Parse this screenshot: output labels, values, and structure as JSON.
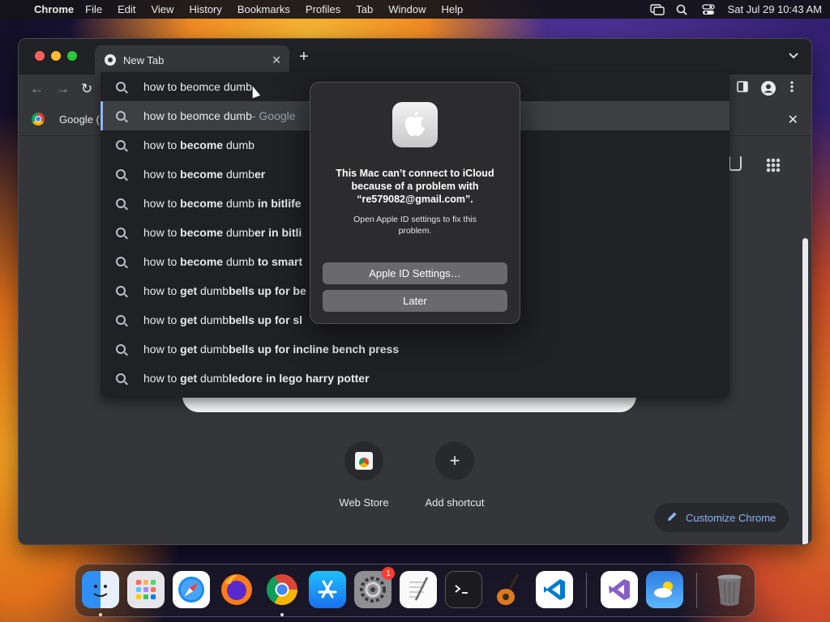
{
  "menubar": {
    "app_name": "Chrome",
    "menus": [
      "File",
      "Edit",
      "View",
      "History",
      "Bookmarks",
      "Profiles",
      "Tab",
      "Window",
      "Help"
    ],
    "datetime": "Sat Jul 29  10:43 AM"
  },
  "browser": {
    "tab_title": "New Tab",
    "bookmark_label": "Google (",
    "omnibox_text": "how to beomce dumb"
  },
  "suggestions": [
    {
      "plain": "how to beomce dumb",
      "bold": "",
      "tail": "",
      "suffix": " - Google"
    },
    {
      "plain": "how to ",
      "bold": "become",
      "tail": " dumb",
      "suffix": ""
    },
    {
      "plain": "how to ",
      "bold": "become",
      "tail": " dumb",
      "bold2": "er",
      "suffix": ""
    },
    {
      "plain": "how to ",
      "bold": "become",
      "tail": " dumb",
      "bold2": " in bitlife",
      "suffix": ""
    },
    {
      "plain": "how to ",
      "bold": "become",
      "tail": " dumb",
      "bold2": "er in bitli",
      "suffix": ""
    },
    {
      "plain": "how to ",
      "bold": "become",
      "tail": " dumb",
      "bold2": " to smart",
      "suffix": ""
    },
    {
      "plain": "how to ",
      "bold": "get",
      "tail": " dumb",
      "bold2": "bells up for be",
      "suffix": ""
    },
    {
      "plain": "how to ",
      "bold": "get",
      "tail": " dumb",
      "bold2": "bells up for sl",
      "suffix": ""
    },
    {
      "plain": "how to ",
      "bold": "get",
      "tail": " dumb",
      "bold2": "bells up for incline bench press",
      "suffix": ""
    },
    {
      "plain": "how to ",
      "bold": "get",
      "tail": " dumb",
      "bold2": "ledore in lego harry potter",
      "suffix": ""
    }
  ],
  "alert": {
    "title": "This Mac can’t connect to iCloud because of a problem with “re579082@gmail.com”.",
    "message": "Open Apple ID settings to fix this problem.",
    "primary_button": "Apple ID Settings…",
    "secondary_button": "Later"
  },
  "ntp": {
    "shortcuts": [
      {
        "label": "Web Store",
        "icon": "web-store-icon"
      },
      {
        "label": "Add shortcut",
        "icon": "plus-icon",
        "glyph": "+"
      }
    ],
    "customize_label": "Customize Chrome"
  },
  "dock": {
    "apps": [
      "finder",
      "launchpad",
      "safari",
      "firefox",
      "chrome",
      "app-store",
      "system-settings",
      "textedit",
      "terminal",
      "garageband",
      "vscode",
      "visual-studio",
      "weather",
      "trash"
    ],
    "system_settings_badge": "1"
  },
  "colors": {
    "accent_blue": "#8ab4f8",
    "omnibox_bg": "#202124",
    "window_bg": "#35363a"
  }
}
